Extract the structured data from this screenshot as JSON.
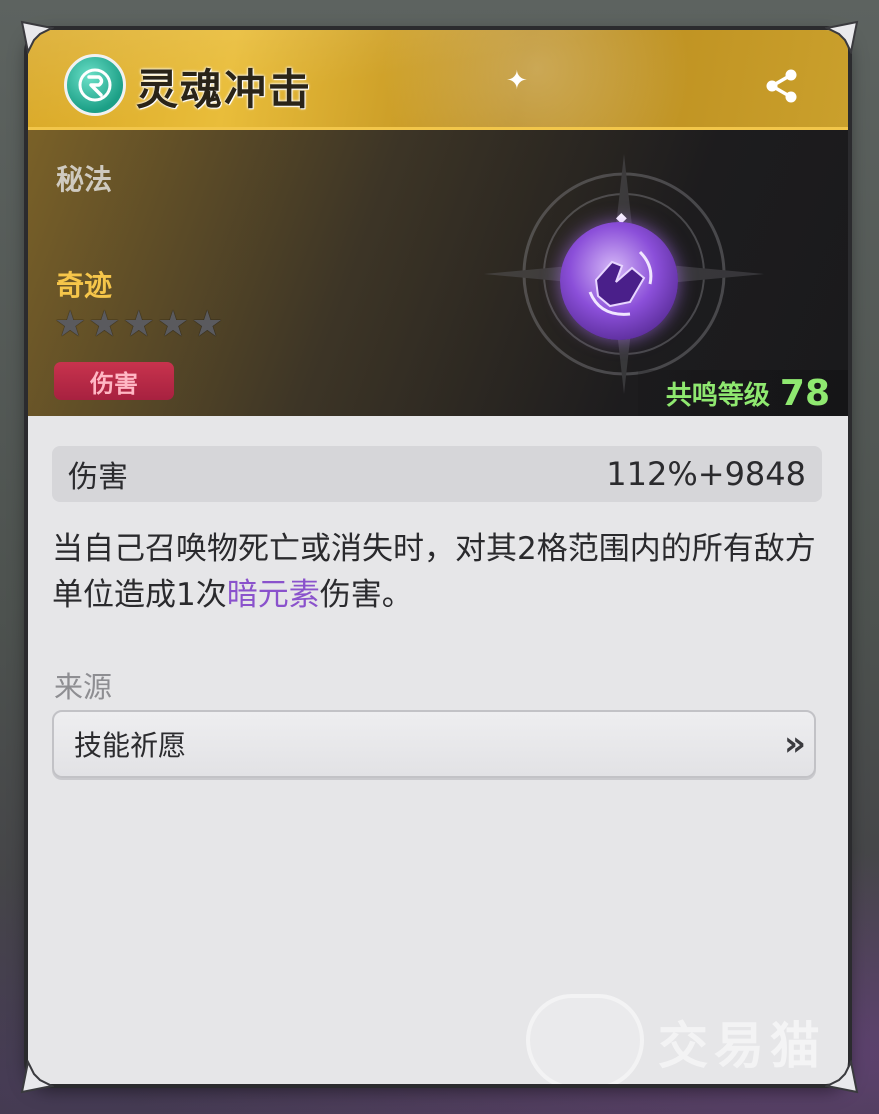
{
  "skill": {
    "title": "灵魂冲击",
    "icon": "spirit-rune-icon",
    "category": "秘法",
    "rarity": "奇迹",
    "stars_total": 5,
    "stars_filled": 0,
    "tag": "伤害",
    "resonance_label": "共鸣等级",
    "resonance_level": "78"
  },
  "stat": {
    "name": "伤害",
    "value": "112%+9848"
  },
  "description": {
    "before": "当自己召唤物死亡或消失时，对其2格范围内的所有敌方单位造成1次",
    "element": "暗元素",
    "after": "伤害。"
  },
  "source": {
    "label": "来源",
    "item": "技能祈愿",
    "arrow": "»"
  },
  "watermark": {
    "text": "交易猫"
  },
  "colors": {
    "header_gold": "#e9bd3a",
    "rarity_gold": "#f6c64a",
    "tag_red": "#c8334d",
    "resonance_green": "#8fe870",
    "element_purple": "#8a52cc"
  }
}
